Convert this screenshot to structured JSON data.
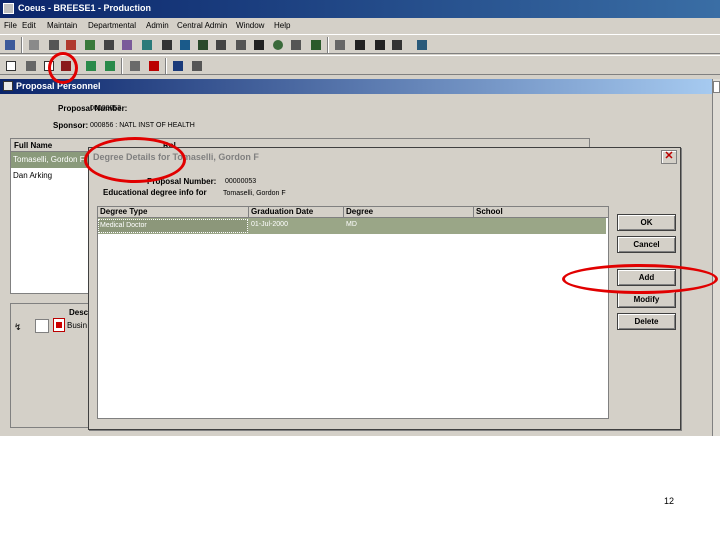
{
  "app": {
    "title": "Coeus - BREESE1 - Production",
    "menu": [
      "File",
      "Edit",
      "Maintain",
      "Departmental",
      "Admin",
      "Central Admin",
      "Window",
      "Help"
    ]
  },
  "toolbar": {
    "row1_icons": [
      "save-icon",
      "cut-icon",
      "print-icon",
      "proposal-icon",
      "folder-icon",
      "grid-icon",
      "network-icon",
      "money-icon",
      "people-icon",
      "persons-icon",
      "book-icon",
      "columns-icon",
      "globe-icon",
      "building-icon",
      "printer-icon",
      "sort-icon",
      "list-icon",
      "split-icon",
      "window-icon",
      "cascade-icon"
    ],
    "row2_icons": [
      "document-icon",
      "pencil-icon",
      "copy-icon",
      "degree-icon",
      "up-arrow-icon",
      "down-arrow-icon",
      "report-icon",
      "pdf-icon",
      "disk-icon",
      "exit-icon"
    ]
  },
  "proposal_personnel": {
    "title": "Proposal Personnel",
    "proposal_number_label": "Proposal Number:",
    "proposal_number": "00000053",
    "sponsor_label": "Sponsor:",
    "sponsor": "000856 : NATL INST OF HEALTH",
    "table": {
      "header_full_name": "Full Name",
      "header_role": "Rol",
      "rows": [
        "Tomaselli, Gordon F",
        "Dan Arking"
      ]
    },
    "documents": {
      "header": "Desc",
      "item": "Busin"
    }
  },
  "degree_dialog": {
    "title": "Degree Details for Tomaselli, Gordon F",
    "proposal_number_label": "Proposal Number:",
    "proposal_number": "00000053",
    "edu_label": "Educational degree info for",
    "edu_value": "Tomaselli, Gordon F",
    "columns": [
      "Degree Type",
      "Graduation Date",
      "Degree",
      "School"
    ],
    "rows": [
      {
        "degree_type": "Medical Doctor",
        "graduation_date": "01-Jul-2000",
        "degree": "MD",
        "school": ""
      }
    ],
    "buttons": {
      "ok": "OK",
      "cancel": "Cancel",
      "add": "Add",
      "modify": "Modify",
      "delete": "Delete"
    }
  },
  "slide": {
    "page_number": "12"
  },
  "colors": {
    "annotation": "#e10000",
    "title_gradient_start": "#0a246a",
    "selected_row": "#9aa687"
  }
}
